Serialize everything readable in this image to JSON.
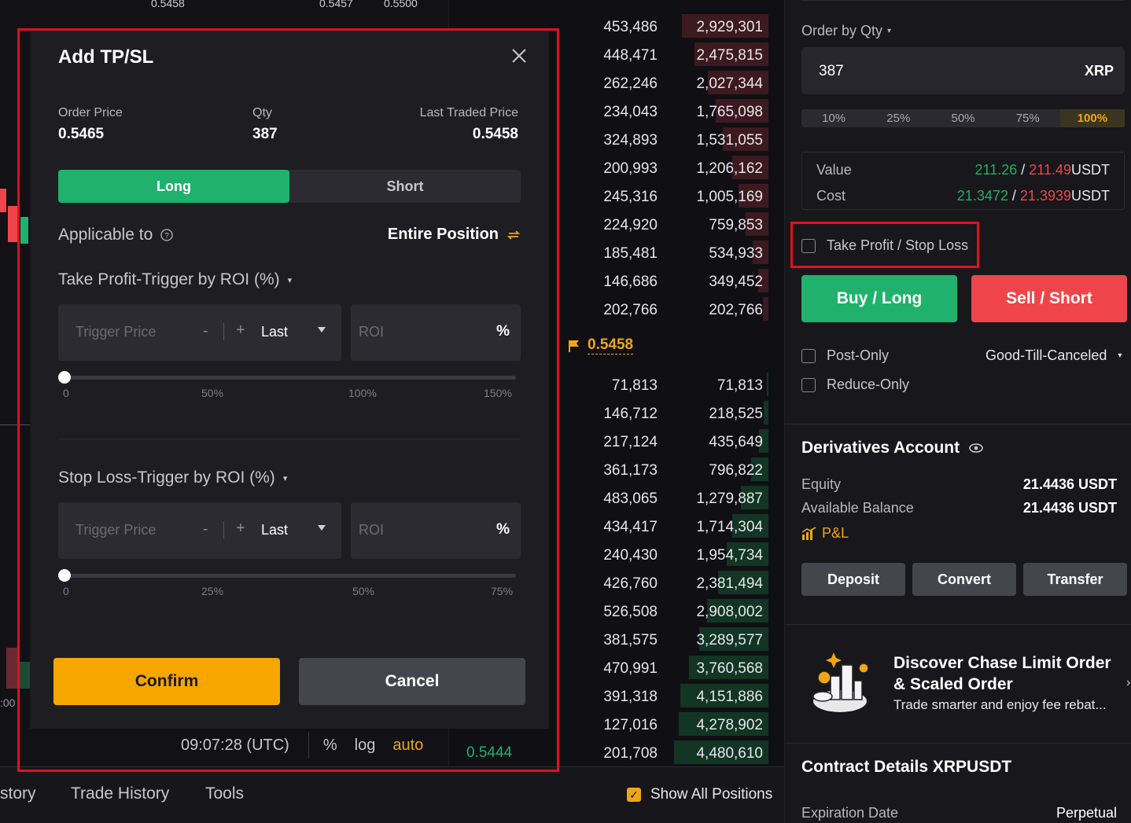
{
  "chart": {
    "top_labels": [
      "0.5458",
      "0.5457",
      "0.5500"
    ],
    "bottom_time": "09:07:28 (UTC)",
    "bottom_pct": "%",
    "bottom_log": "log",
    "bottom_auto": "auto",
    "left_axis_label": ":00"
  },
  "orderbook": {
    "asks": [
      {
        "qty": "453,486",
        "total": "2,929,301"
      },
      {
        "qty": "448,471",
        "total": "2,475,815"
      },
      {
        "qty": "262,246",
        "total": "2,027,344"
      },
      {
        "qty": "234,043",
        "total": "1,765,098"
      },
      {
        "qty": "324,893",
        "total": "1,531,055"
      },
      {
        "qty": "200,993",
        "total": "1,206,162"
      },
      {
        "qty": "245,316",
        "total": "1,005,169"
      },
      {
        "qty": "224,920",
        "total": "759,853"
      },
      {
        "qty": "185,481",
        "total": "534,933"
      },
      {
        "qty": "146,686",
        "total": "349,452"
      },
      {
        "qty": "202,766",
        "total": "202,766"
      }
    ],
    "ask_fill": [
      0.92,
      0.78,
      0.64,
      0.56,
      0.48,
      0.38,
      0.32,
      0.24,
      0.17,
      0.11,
      0.06
    ],
    "mid_price": "0.5458",
    "bids": [
      {
        "qty": "71,813",
        "total": "71,813"
      },
      {
        "qty": "146,712",
        "total": "218,525"
      },
      {
        "qty": "217,124",
        "total": "435,649"
      },
      {
        "qty": "361,173",
        "total": "796,822"
      },
      {
        "qty": "483,065",
        "total": "1,279,887"
      },
      {
        "qty": "434,417",
        "total": "1,714,304"
      },
      {
        "qty": "240,430",
        "total": "1,954,734"
      },
      {
        "qty": "426,760",
        "total": "2,381,494"
      },
      {
        "qty": "526,508",
        "total": "2,908,002"
      },
      {
        "qty": "381,575",
        "total": "3,289,577"
      },
      {
        "qty": "470,991",
        "total": "3,760,568"
      },
      {
        "qty": "391,318",
        "total": "4,151,886"
      },
      {
        "qty": "127,016",
        "total": "4,278,902"
      },
      {
        "qty": "201,708",
        "total": "4,480,610"
      }
    ],
    "bid_fill": [
      0.02,
      0.05,
      0.1,
      0.18,
      0.29,
      0.38,
      0.44,
      0.53,
      0.65,
      0.73,
      0.84,
      0.93,
      0.95,
      1.0
    ],
    "bottom_price": "0.5444"
  },
  "bottom_tabs": {
    "tab1": "story",
    "tab2": "Trade History",
    "tab3": "Tools",
    "show_all": "Show All Positions"
  },
  "right": {
    "order_by": "Order by Qty",
    "qty_value": "387",
    "qty_unit": "XRP",
    "pcts": [
      "10%",
      "25%",
      "50%",
      "75%",
      "100%"
    ],
    "value_label": "Value",
    "value_long": "211.26",
    "value_short": "211.49",
    "cost_label": "Cost",
    "cost_long": "21.3472",
    "cost_short": "21.3939",
    "unit": "USDT",
    "slash": "/",
    "tpsl_label": "Take Profit / Stop Loss",
    "buy_label": "Buy / Long",
    "sell_label": "Sell / Short",
    "post_only": "Post-Only",
    "gtc": "Good-Till-Canceled",
    "reduce_only": "Reduce-Only",
    "deriv_title": "Derivatives Account",
    "equity_label": "Equity",
    "equity_value": "21.4436 USDT",
    "avail_label": "Available Balance",
    "avail_value": "21.4436 USDT",
    "pnl_label": "P&L",
    "deposit": "Deposit",
    "convert": "Convert",
    "transfer": "Transfer",
    "promo_title": "Discover Chase Limit Order & Scaled Order",
    "promo_sub": "Trade smarter and enjoy fee rebat...",
    "contract_title": "Contract Details XRPUSDT",
    "expiration_label": "Expiration Date",
    "expiration_value": "Perpetual"
  },
  "modal": {
    "title": "Add TP/SL",
    "order_price_label": "Order Price",
    "order_price": "0.5465",
    "qty_label": "Qty",
    "qty": "387",
    "ltp_label": "Last Traded Price",
    "ltp": "0.5458",
    "long": "Long",
    "short": "Short",
    "applicable_label": "Applicable to",
    "applicable_value": "Entire Position",
    "tp_title": "Take Profit-Trigger by ROI (%)",
    "sl_title": "Stop Loss-Trigger by ROI (%)",
    "trigger_placeholder": "Trigger Price",
    "minus": "-",
    "plus": "+",
    "last": "Last",
    "roi_placeholder": "ROI",
    "pct": "%",
    "tp_ticks": [
      "0",
      "50%",
      "100%",
      "150%"
    ],
    "sl_ticks": [
      "0",
      "25%",
      "50%",
      "75%"
    ],
    "confirm": "Confirm",
    "cancel": "Cancel"
  },
  "colors": {
    "green": "#20b26c",
    "red": "#ef454a",
    "accent": "#f0a614",
    "highlight_border": "#e3101a"
  }
}
